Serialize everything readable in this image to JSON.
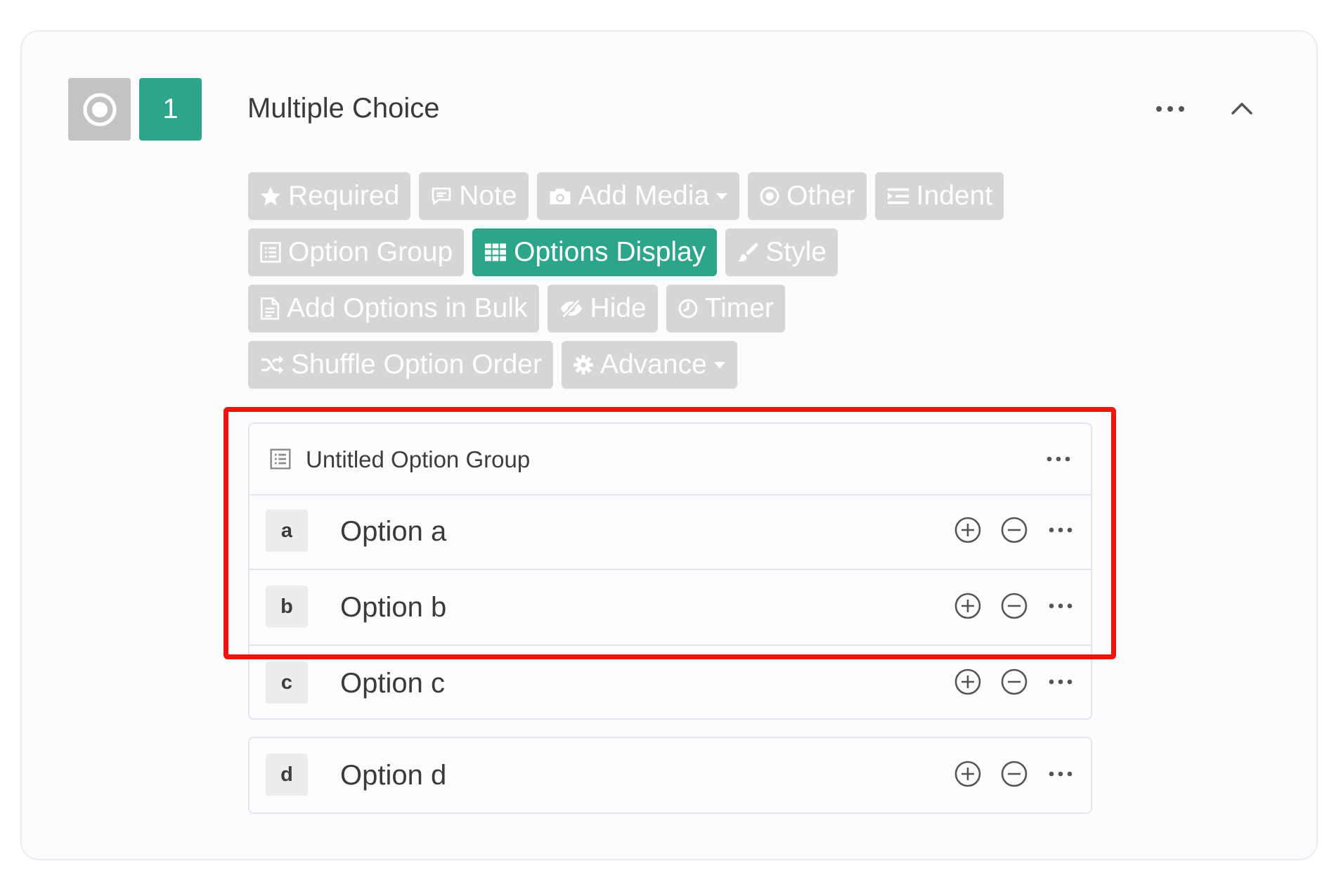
{
  "question": {
    "number": "1",
    "title": "Multiple Choice",
    "type_icon": "radio-circle-icon"
  },
  "toolbar": {
    "required": "Required",
    "note": "Note",
    "add_media": "Add Media",
    "other": "Other",
    "indent": "Indent",
    "option_group": "Option Group",
    "options_display": "Options Display",
    "style": "Style",
    "add_bulk": "Add Options in Bulk",
    "hide": "Hide",
    "timer": "Timer",
    "shuffle": "Shuffle Option Order",
    "advance": "Advance"
  },
  "option_group": {
    "title": "Untitled Option Group",
    "options": [
      {
        "letter": "a",
        "label": "Option a"
      },
      {
        "letter": "b",
        "label": "Option b"
      },
      {
        "letter": "c",
        "label": "Option c"
      }
    ]
  },
  "ungrouped_options": [
    {
      "letter": "d",
      "label": "Option d"
    }
  ],
  "colors": {
    "accent": "#2da58a",
    "button_gray": "#d6d6d6",
    "highlight": "#f0140f"
  }
}
